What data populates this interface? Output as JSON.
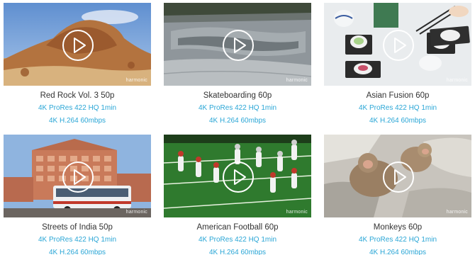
{
  "videos": [
    {
      "title": "Red Rock Vol. 3 50p",
      "link_prores": "4K ProRes 422 HQ 1min",
      "link_h264": "4K H.264 60mbps",
      "watermark": "harmonic"
    },
    {
      "title": "Skateboarding 60p",
      "link_prores": "4K ProRes 422 HQ 1min",
      "link_h264": "4K H.264 60mbps",
      "watermark": "harmonic"
    },
    {
      "title": "Asian Fusion 60p",
      "link_prores": "4K ProRes 422 HQ 1min",
      "link_h264": "4K H.264 60mbps",
      "watermark": "harmonic"
    },
    {
      "title": "Streets of India 50p",
      "link_prores": "4K ProRes 422 HQ 1min",
      "link_h264": "4K H.264 60mbps",
      "watermark": "harmonic"
    },
    {
      "title": "American Football 60p",
      "link_prores": "4K ProRes 422 HQ 1min",
      "link_h264": "4K H.264 60mbps",
      "watermark": "harmonic"
    },
    {
      "title": "Monkeys 60p",
      "link_prores": "4K ProRes 422 HQ 1min",
      "link_h264": "4K H.264 60mbps",
      "watermark": "harmonic"
    }
  ],
  "colors": {
    "link": "#2aa6d6",
    "title": "#333333"
  }
}
